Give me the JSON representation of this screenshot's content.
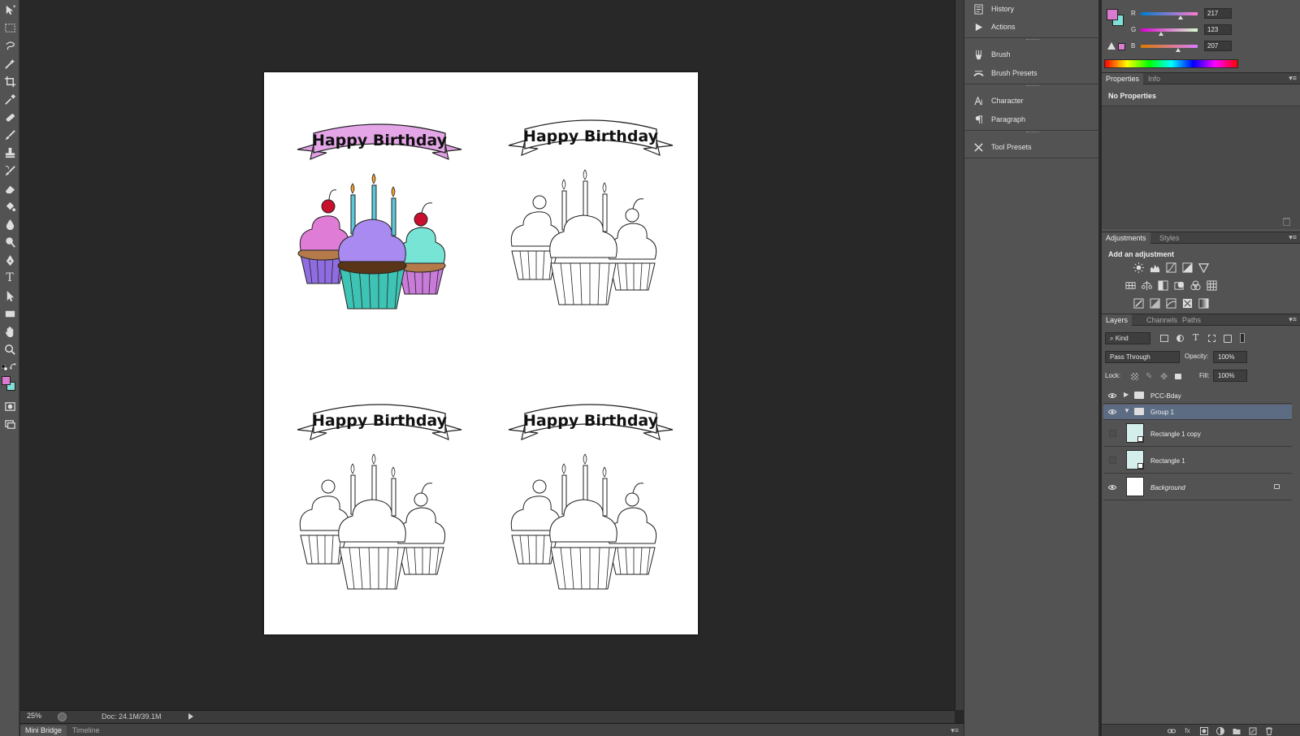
{
  "colors": {
    "foreground": "#d97bcf",
    "background": "#7fe0d6",
    "layer_selected": "#5c6c83"
  },
  "toolbar": {
    "tools": [
      "move-icon",
      "marquee-icon",
      "lasso-icon",
      "magic-wand-icon",
      "crop-icon",
      "eyedropper-icon",
      "healing-brush-icon",
      "brush-icon",
      "clone-stamp-icon",
      "history-brush-icon",
      "eraser-icon",
      "paint-bucket-icon",
      "blur-icon",
      "dodge-icon",
      "pen-icon",
      "type-icon",
      "path-select-icon",
      "rectangle-icon",
      "hand-icon",
      "zoom-icon"
    ],
    "type_glyph": "T"
  },
  "canvas": {
    "card_title": "Happy Birthday"
  },
  "statusbar": {
    "zoom": "25%",
    "doc_info": "Doc: 24.1M/39.1M"
  },
  "bottom_tabs": [
    "Mini Bridge",
    "Timeline"
  ],
  "mid_panels": [
    {
      "label": "History",
      "icon": "history-icon"
    },
    {
      "label": "Actions",
      "icon": "actions-icon"
    },
    {
      "label": "Brush",
      "icon": "brush-panel-icon"
    },
    {
      "label": "Brush Presets",
      "icon": "brush-presets-icon"
    },
    {
      "label": "Character",
      "icon": "character-icon"
    },
    {
      "label": "Paragraph",
      "icon": "paragraph-icon"
    },
    {
      "label": "Tool Presets",
      "icon": "tool-presets-icon"
    }
  ],
  "color_panel": {
    "channels": [
      {
        "label": "R",
        "value": "217"
      },
      {
        "label": "G",
        "value": "123"
      },
      {
        "label": "B",
        "value": "207"
      }
    ]
  },
  "properties_panel": {
    "tabs": [
      "Properties",
      "Info"
    ],
    "message": "No Properties"
  },
  "adjustments_panel": {
    "tabs": [
      "Adjustments",
      "Styles"
    ],
    "heading": "Add an adjustment"
  },
  "layers_panel": {
    "tabs": [
      "Layers",
      "Channels",
      "Paths"
    ],
    "filter_kind": "Kind",
    "blend_mode": "Pass Through",
    "opacity_label": "Opacity:",
    "opacity": "100%",
    "lock_label": "Lock:",
    "fill_label": "Fill:",
    "fill": "100%",
    "layers": [
      {
        "name": "PCC-Bday",
        "type": "group",
        "visible": true,
        "selected": false
      },
      {
        "name": "Group 1",
        "type": "group",
        "visible": true,
        "selected": true
      },
      {
        "name": "Rectangle 1 copy",
        "type": "shape",
        "visible": false,
        "selected": false
      },
      {
        "name": "Rectangle 1",
        "type": "shape",
        "visible": false,
        "selected": false
      },
      {
        "name": "Background",
        "type": "background",
        "visible": true,
        "selected": false
      }
    ]
  }
}
